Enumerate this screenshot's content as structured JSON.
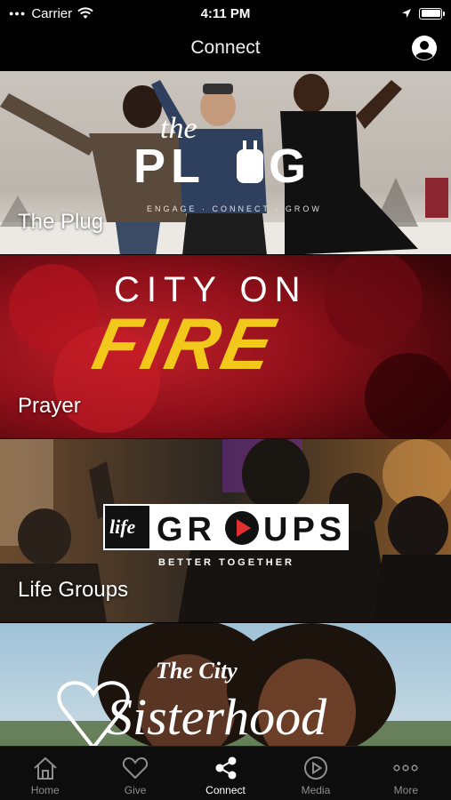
{
  "status_bar": {
    "carrier": "Carrier",
    "time": "4:11 PM",
    "icons": [
      "wifi-icon",
      "location-arrow-icon",
      "battery-icon"
    ]
  },
  "nav": {
    "title": "Connect",
    "profile_icon": "user-profile-icon"
  },
  "cards": [
    {
      "label": "The Plug",
      "logo_text": "PLUG",
      "logo_script": "the",
      "tagline": "ENGAGE · CONNECT · GROW"
    },
    {
      "label": "Prayer",
      "logo_line1": "CITY ON",
      "logo_line2": "FIRE"
    },
    {
      "label": "Life Groups",
      "logo_script": "life",
      "logo_text": "GROUPS",
      "tagline": "BETTER TOGETHER"
    },
    {
      "label": "",
      "logo_script": "The City",
      "logo_text": "Sisterhood"
    }
  ],
  "tabs": [
    {
      "label": "Home",
      "icon": "home-icon",
      "active": false
    },
    {
      "label": "Give",
      "icon": "heart-icon",
      "active": false
    },
    {
      "label": "Connect",
      "icon": "share-icon",
      "active": true
    },
    {
      "label": "Media",
      "icon": "play-circle-icon",
      "active": false
    },
    {
      "label": "More",
      "icon": "more-dots-icon",
      "active": false
    }
  ],
  "colors": {
    "background": "#000000",
    "tab_inactive": "#8e8e8e",
    "tab_active": "#ffffff",
    "fire_red": "#a3121d",
    "fire_yellow": "#f2c81a"
  }
}
